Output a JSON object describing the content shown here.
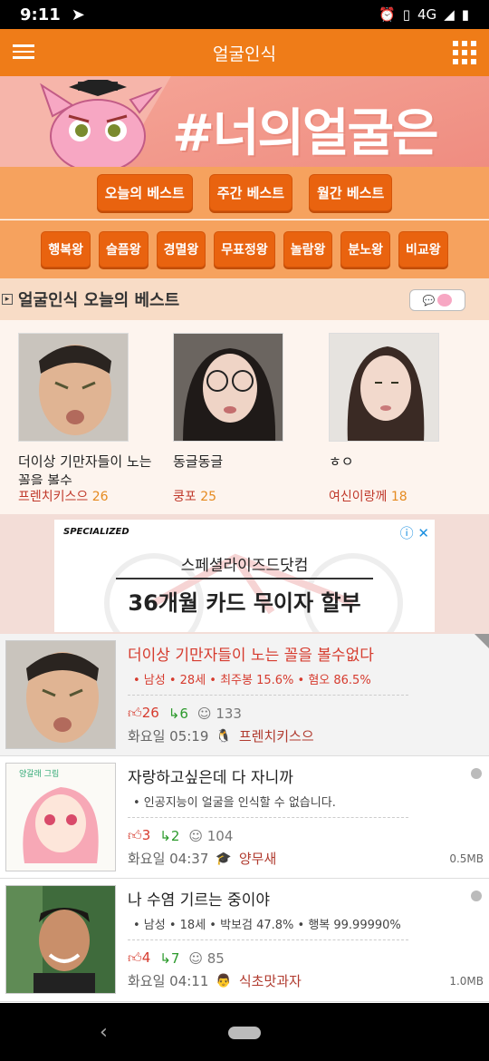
{
  "status_bar": {
    "time": "9:11",
    "network": "4G"
  },
  "app_bar": {
    "title": "얼굴인식"
  },
  "banner": {
    "title": "#너의얼굴은"
  },
  "period_buttons": [
    "오늘의 베스트",
    "주간 베스트",
    "월간 베스트"
  ],
  "mood_buttons": [
    "행복왕",
    "슬픔왕",
    "경멸왕",
    "무표정왕",
    "놀람왕",
    "분노왕",
    "비교왕"
  ],
  "best_section": {
    "title": "얼굴인식 오늘의 베스트",
    "cards": [
      {
        "caption": "더이상 기만자들이 노는 꼴을 볼수",
        "author": "프렌치키스으",
        "count": "26"
      },
      {
        "caption": "동글동글",
        "author": "쿵포",
        "count": "25"
      },
      {
        "caption": "ㅎㅇ",
        "author": "여신이랑께",
        "count": "18"
      }
    ]
  },
  "ad": {
    "brand": "SPECIALIZED",
    "subtitle": "스페셜라이즈드닷컴",
    "headline": "36개월 카드 무이자 할부"
  },
  "posts": [
    {
      "title": "더이상 기만자들이 노는 꼴을 볼수없다",
      "tags": "• 남성  • 28세  • 최주봉 15.6%  • 혐오 86.5%",
      "likes": "26",
      "shares": "6",
      "views": "133",
      "time": "화요일 05:19",
      "author": "프렌치키스으",
      "size": ""
    },
    {
      "title": "자랑하고싶은데 다 자니까",
      "tags": "• 인공지능이 얼굴을 인식할 수 없습니다.",
      "likes": "3",
      "shares": "2",
      "views": "104",
      "time": "화요일 04:37",
      "author": "양무새",
      "size": "0.5MB"
    },
    {
      "title": "나 수염 기르는 중이야",
      "tags": "• 남성  • 18세  • 박보검 47.8%  • 행복 99.99990%",
      "likes": "4",
      "shares": "7",
      "views": "85",
      "time": "화요일 04:11",
      "author": "식초맛과자",
      "size": "1.0MB"
    }
  ],
  "colors": {
    "accent": "#ef7c18",
    "button": "#e9630f",
    "like": "#d63b2e",
    "share": "#2c9a2c"
  }
}
